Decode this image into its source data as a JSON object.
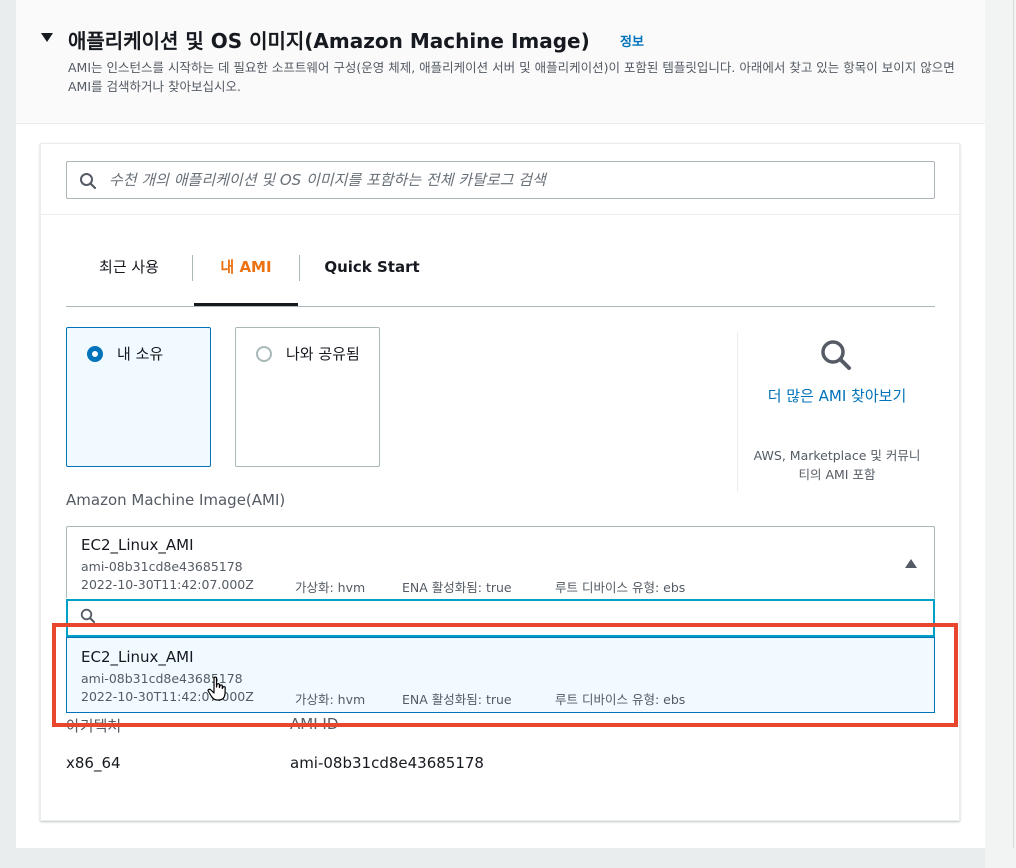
{
  "section": {
    "title": "애플리케이션 및 OS 이미지(Amazon Machine Image)",
    "info_link": "정보",
    "description": "AMI는 인스턴스를 시작하는 데 필요한 소프트웨어 구성(운영 체제, 애플리케이션 서버 및 애플리케이션)이 포함된 템플릿입니다. 아래에서 찾고 있는 항목이 보이지 않으면 AMI를 검색하거나 찾아보십시오."
  },
  "search": {
    "placeholder": "수천 개의 애플리케이션 및 OS 이미지를 포함하는 전체 카탈로그 검색"
  },
  "tabs": [
    {
      "label": "최근 사용"
    },
    {
      "label": "내 AMI"
    },
    {
      "label": "Quick Start"
    }
  ],
  "ownership": {
    "options": [
      {
        "label": "내 소유",
        "selected": true
      },
      {
        "label": "나와 공유됨",
        "selected": false
      }
    ]
  },
  "browse": {
    "link": "더 많은 AMI 찾아보기",
    "subtext": "AWS, Marketplace 및 커뮤니티의 AMI 포함"
  },
  "ami_select": {
    "label": "Amazon Machine Image(AMI)",
    "selected": {
      "name": "EC2_Linux_AMI",
      "id": "ami-08b31cd8e43685178",
      "date": "2022-10-30T11:42:07.000Z",
      "virtualization": "가상화: hvm",
      "ena": "ENA 활성화됨: true",
      "root_device": "루트 디바이스 유형: ebs"
    },
    "filter_value": "",
    "options": [
      {
        "name": "EC2_Linux_AMI",
        "id": "ami-08b31cd8e43685178",
        "date": "2022-10-30T11:42:07.000Z",
        "virtualization": "가상화: hvm",
        "ena": "ENA 활성화됨: true",
        "root_device": "루트 디바이스 유형: ebs"
      }
    ]
  },
  "details": {
    "architecture_label": "아키텍처",
    "architecture_value": "x86_64",
    "ami_id_label": "AMI ID",
    "ami_id_value": "ami-08b31cd8e43685178"
  },
  "colors": {
    "link": "#0073bb",
    "active_tab": "#ec7211",
    "highlight": "#e8472d",
    "focus": "#00a1c9"
  }
}
